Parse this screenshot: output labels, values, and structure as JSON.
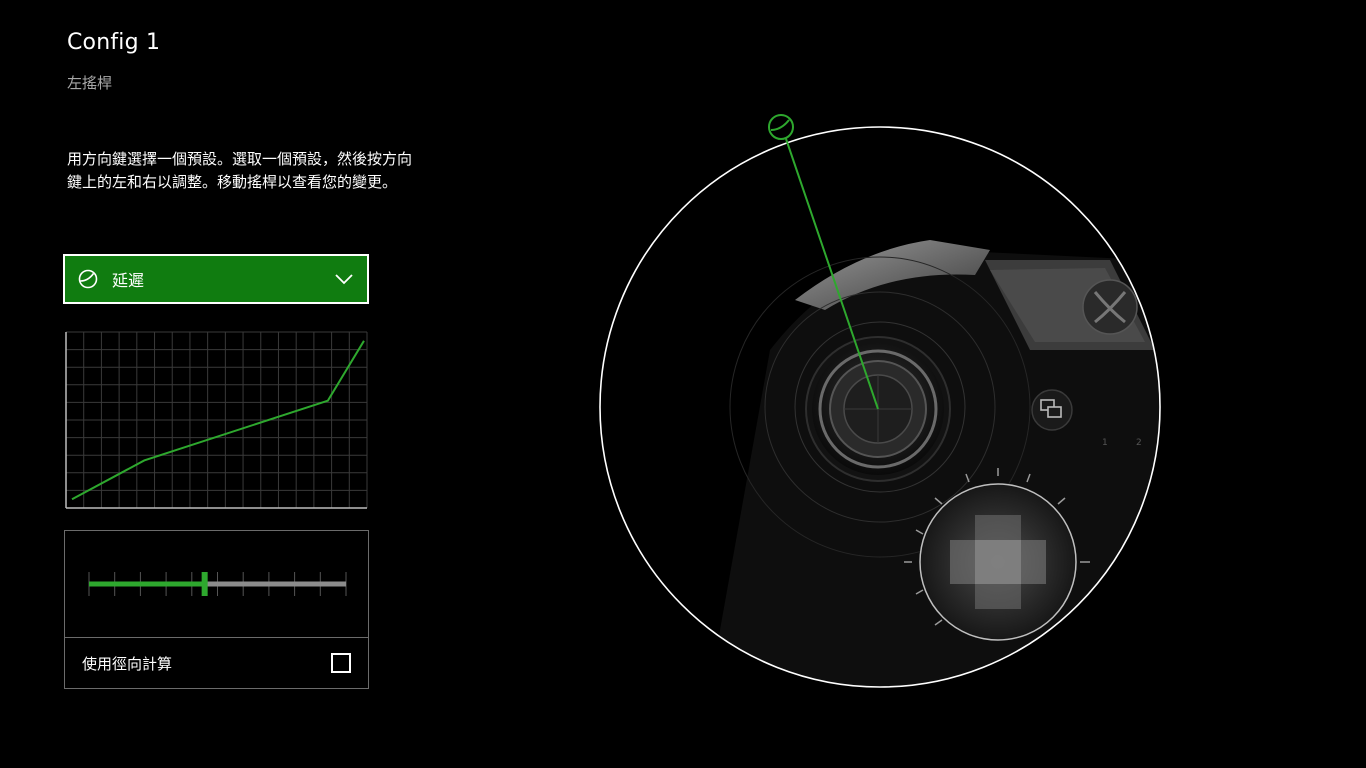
{
  "header": {
    "title": "Config 1",
    "subtitle": "左搖桿"
  },
  "instructions": "用方向鍵選擇一個預設。選取一個預設，然後按方向鍵上的左和右以調整。移動搖桿以查看您的變更。",
  "preset": {
    "label": "延遲",
    "icon": "response-curve-icon",
    "chevron_icon": "chevron-down-icon"
  },
  "response_curve": {
    "points": [
      [
        0,
        0.05
      ],
      [
        0.24,
        0.27
      ],
      [
        0.85,
        0.61
      ],
      [
        0.97,
        0.95
      ]
    ]
  },
  "deadzone_slider": {
    "value": 0.45,
    "tick_count": 10
  },
  "radial": {
    "label": "使用徑向計算",
    "checked": false
  },
  "colors": {
    "accent": "#107c10",
    "line": "#2ea82e",
    "background": "#000000"
  },
  "controller": {
    "stick_indicator_icon": "stick-position-icon",
    "view_button_icon": "view-button-icon",
    "xbox_logo_icon": "xbox-logo-icon"
  }
}
